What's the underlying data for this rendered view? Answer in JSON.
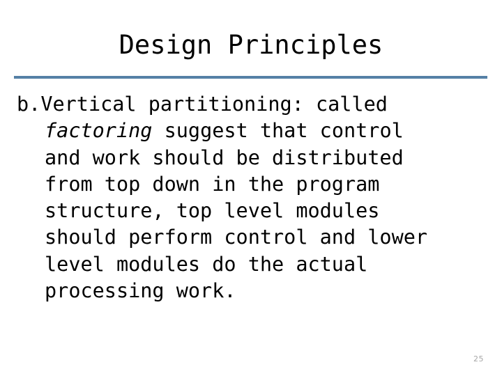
{
  "slide": {
    "title": "Design Principles",
    "divider_color": "#5580a6",
    "background_color": "#ffffff",
    "text_color": "#000000",
    "page_number": "25",
    "page_number_color": "#a6a6a6",
    "body_lines": [
      {
        "text": "b.Vertical partitioning: called",
        "indent": false,
        "italic_word": ""
      },
      {
        "text": " suggest that control",
        "indent": true,
        "italic_word": "factoring"
      },
      {
        "text": "and work should be distributed",
        "indent": true,
        "italic_word": ""
      },
      {
        "text": "from top down in the program",
        "indent": true,
        "italic_word": ""
      },
      {
        "text": "structure, top level modules",
        "indent": true,
        "italic_word": ""
      },
      {
        "text": "should perform control and lower",
        "indent": true,
        "italic_word": ""
      },
      {
        "text": "level modules do the actual",
        "indent": true,
        "italic_word": ""
      },
      {
        "text": "processing work.",
        "indent": true,
        "italic_word": ""
      }
    ]
  }
}
